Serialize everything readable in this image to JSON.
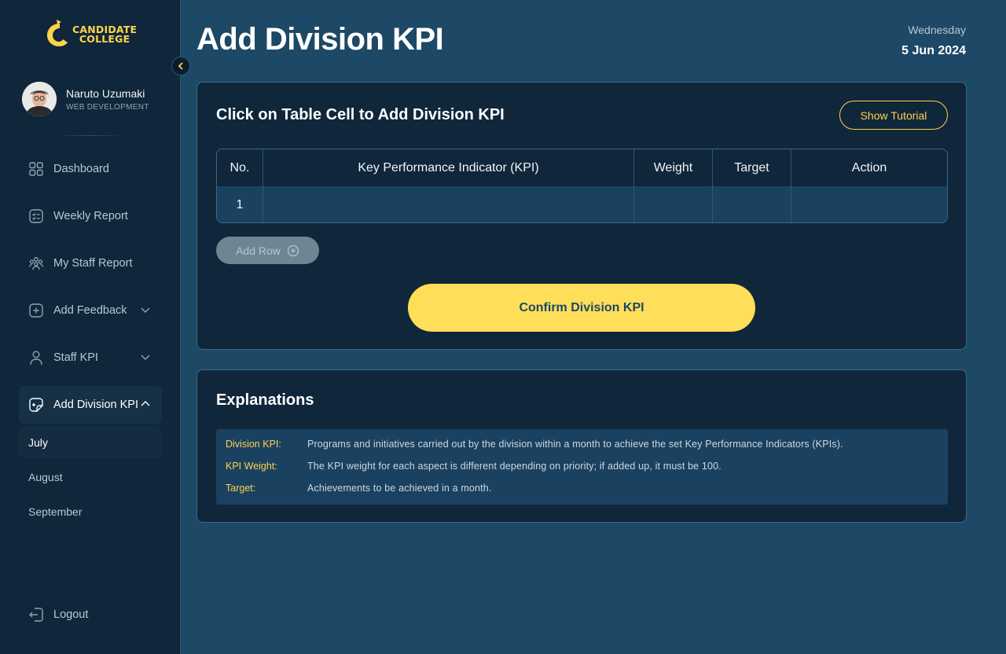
{
  "brand": {
    "logo_line1": "CANDIDATE",
    "logo_line2": "COLLEGE"
  },
  "user": {
    "name": "Naruto Uzumaki",
    "role": "WEB DEVELOPMENT"
  },
  "sidebar": {
    "items": [
      {
        "label": "Dashboard",
        "icon": "grid-icon"
      },
      {
        "label": "Weekly Report",
        "icon": "checklist-icon"
      },
      {
        "label": "My Staff Report",
        "icon": "team-icon"
      },
      {
        "label": "Add Feedback",
        "icon": "plus-square-icon",
        "expandable": true
      },
      {
        "label": "Staff KPI",
        "icon": "user-icon",
        "expandable": true
      },
      {
        "label": "Add Division KPI",
        "icon": "document-plus-icon",
        "expandable": true,
        "expanded": true,
        "active": true
      }
    ],
    "sub_items": [
      "July",
      "August",
      "September"
    ],
    "active_sub_item": "July",
    "logout_label": "Logout"
  },
  "header": {
    "title": "Add Division KPI",
    "day": "Wednesday",
    "date": "5 Jun 2024"
  },
  "kpi_card": {
    "title": "Click on Table Cell to Add Division KPI",
    "tutorial_label": "Show Tutorial",
    "table": {
      "headers": [
        "No.",
        "Key Performance Indicator (KPI)",
        "Weight",
        "Target",
        "Action"
      ],
      "rows": [
        [
          "1",
          "",
          "",
          "",
          ""
        ]
      ]
    },
    "add_row_label": "Add Row",
    "confirm_label": "Confirm Division KPI"
  },
  "explanations": {
    "title": "Explanations",
    "items": [
      {
        "term": "Division KPI:",
        "desc": "Programs and initiatives carried out by the division within a month to achieve the set Key Performance Indicators (KPIs)."
      },
      {
        "term": "KPI Weight:",
        "desc": "The KPI weight for each aspect is different depending on priority; if added up, it must be 100."
      },
      {
        "term": "Target:",
        "desc": "Achievements to be achieved in a month."
      }
    ]
  },
  "colors": {
    "accent": "#ffd34d",
    "confirm_button": "#ffde59",
    "sidebar_bg": "#10263a",
    "main_bg": "#1d4866"
  }
}
